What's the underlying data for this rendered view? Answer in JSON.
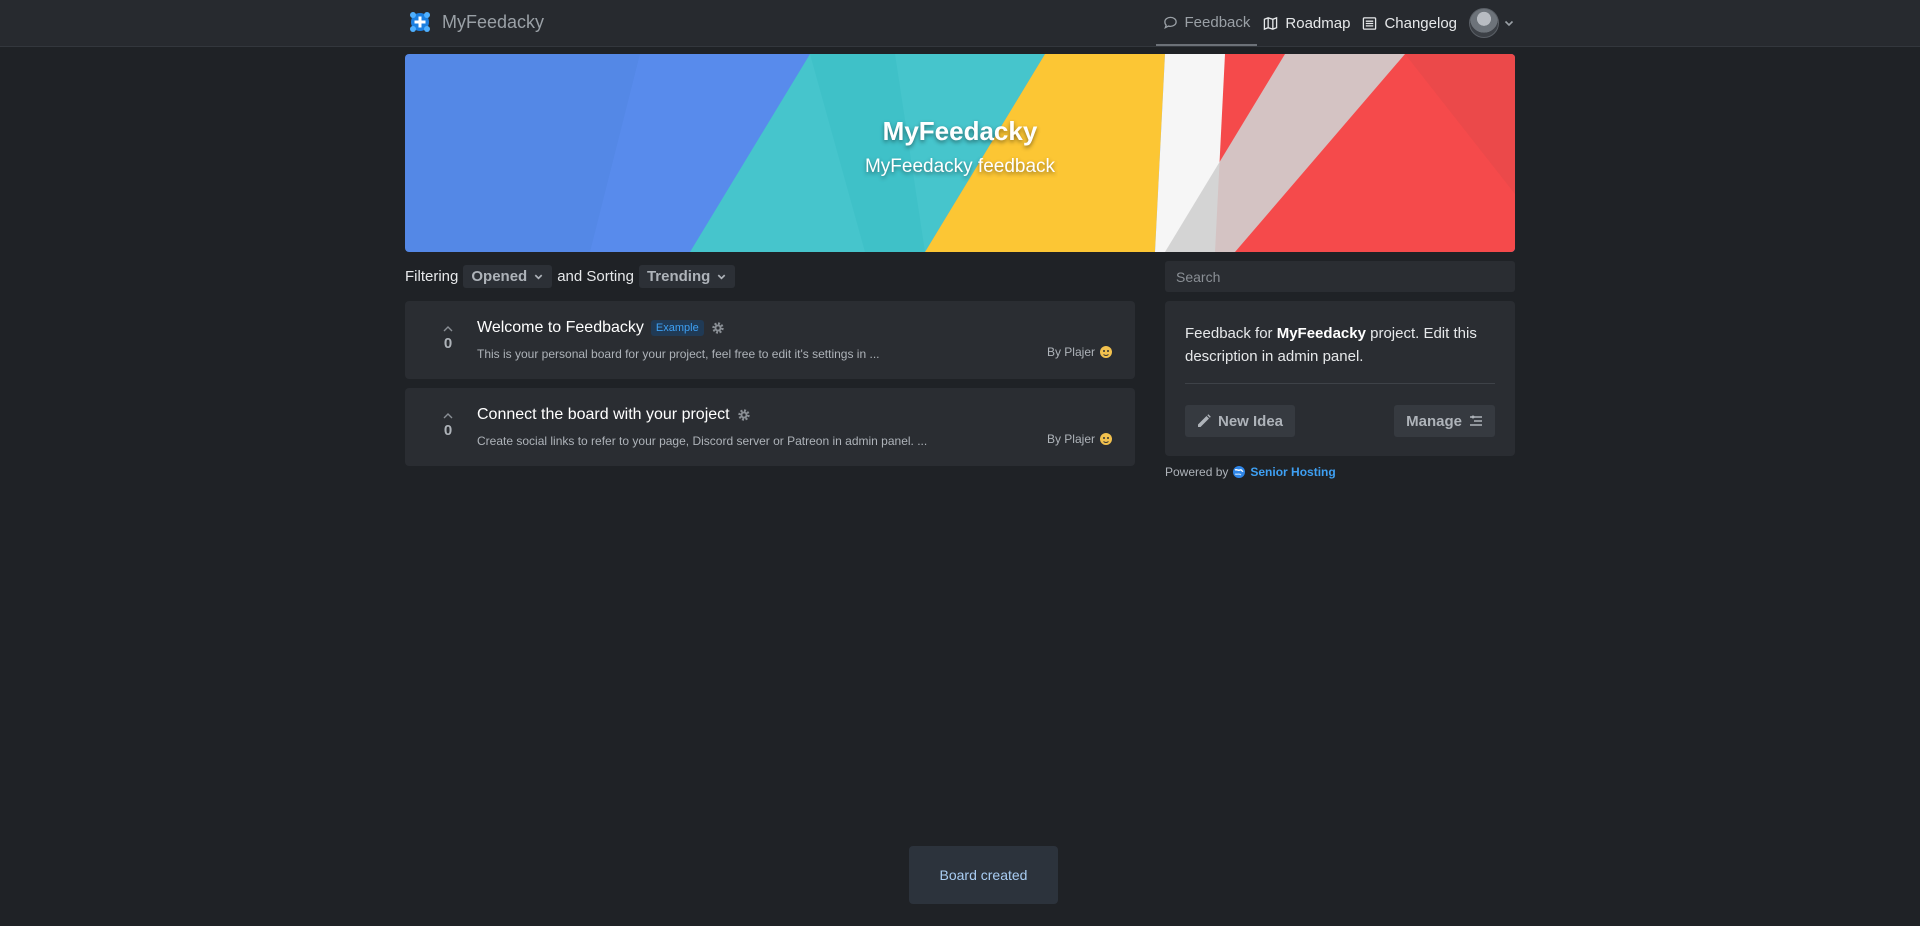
{
  "nav": {
    "brand": "MyFeedacky",
    "links": [
      {
        "label": "Feedback",
        "icon": "chat-bubble-icon",
        "active": true
      },
      {
        "label": "Roadmap",
        "icon": "map-icon",
        "active": false
      },
      {
        "label": "Changelog",
        "icon": "list-icon",
        "active": false
      }
    ]
  },
  "hero": {
    "title": "MyFeedacky",
    "subtitle": "MyFeedacky feedback"
  },
  "filters": {
    "filtering_label": "Filtering",
    "filter_value": "Opened",
    "sorting_label": "and Sorting",
    "sort_value": "Trending"
  },
  "posts": [
    {
      "votes": "0",
      "title": "Welcome to Feedbacky",
      "badge": "Example",
      "description": "This is your personal board for your project, feel free to edit it's settings in ...",
      "author": "By Plajer"
    },
    {
      "votes": "0",
      "title": "Connect the board with your project",
      "badge": "",
      "description": "Create social links to refer to your page, Discord server or Patreon in admin panel. ...",
      "author": "By Plajer"
    }
  ],
  "sidebar": {
    "search_placeholder": "Search",
    "desc_prefix": "Feedback for ",
    "desc_project": "MyFeedacky",
    "desc_suffix": " project. Edit this description in admin panel.",
    "new_idea_label": "New Idea",
    "manage_label": "Manage",
    "powered_by": "Powered by",
    "powered_link": "Senior Hosting"
  },
  "toast": {
    "message": "Board created"
  },
  "colors": {
    "background": "#1f2226",
    "card": "#2a2d32",
    "accent": "#3ea0f3"
  }
}
